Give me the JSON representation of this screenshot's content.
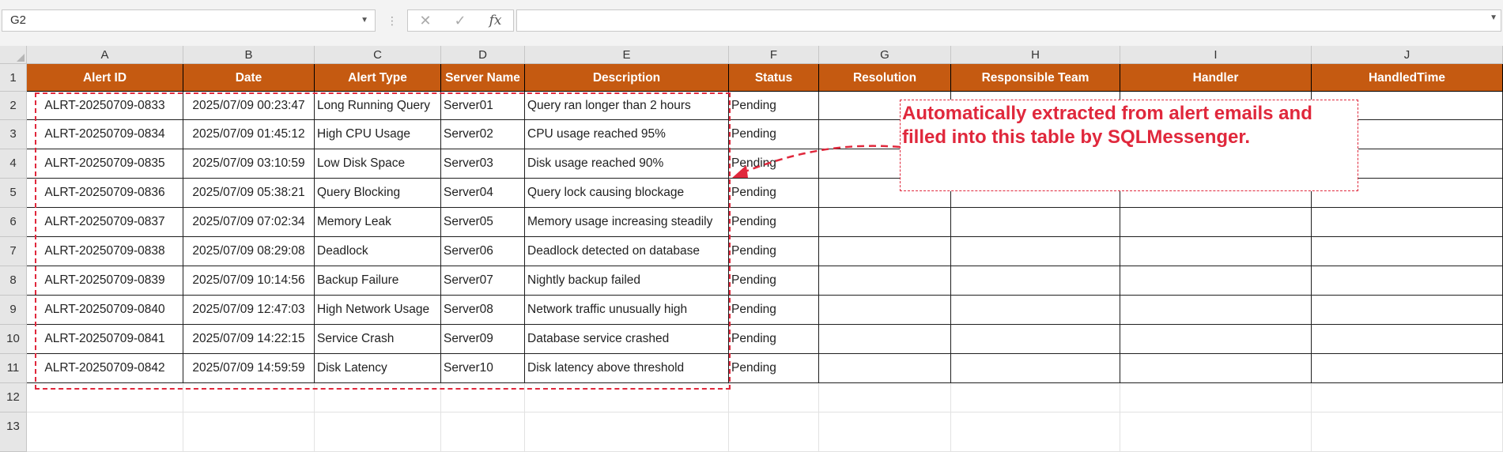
{
  "name_box": {
    "value": "G2"
  },
  "formula_bar": {
    "cancel_icon": "✕",
    "enter_icon": "✓",
    "fx_label": "fx",
    "formula": ""
  },
  "columns": [
    "A",
    "B",
    "C",
    "D",
    "E",
    "F",
    "G",
    "H",
    "I",
    "J"
  ],
  "rows": [
    "1",
    "2",
    "3",
    "4",
    "5",
    "6",
    "7",
    "8",
    "9",
    "10",
    "11",
    "12",
    "13"
  ],
  "table": {
    "headers": [
      "Alert ID",
      "Date",
      "Alert Type",
      "Server Name",
      "Description",
      "Status",
      "Resolution",
      "Responsible Team",
      "Handler",
      "HandledTime"
    ],
    "records": [
      [
        "ALRT-20250709-0833",
        "2025/07/09 00:23:47",
        "Long Running Query",
        "Server01",
        "Query ran longer than 2 hours",
        "Pending",
        "",
        "",
        "",
        ""
      ],
      [
        "ALRT-20250709-0834",
        "2025/07/09 01:45:12",
        "High CPU Usage",
        "Server02",
        "CPU usage reached 95%",
        "Pending",
        "",
        "",
        "",
        ""
      ],
      [
        "ALRT-20250709-0835",
        "2025/07/09 03:10:59",
        "Low Disk Space",
        "Server03",
        "Disk usage reached 90%",
        "Pending",
        "",
        "",
        "",
        ""
      ],
      [
        "ALRT-20250709-0836",
        "2025/07/09 05:38:21",
        "Query Blocking",
        "Server04",
        "Query lock causing blockage",
        "Pending",
        "",
        "",
        "",
        ""
      ],
      [
        "ALRT-20250709-0837",
        "2025/07/09 07:02:34",
        "Memory Leak",
        "Server05",
        "Memory usage increasing steadily",
        "Pending",
        "",
        "",
        "",
        ""
      ],
      [
        "ALRT-20250709-0838",
        "2025/07/09 08:29:08",
        "Deadlock",
        "Server06",
        "Deadlock detected on database",
        "Pending",
        "",
        "",
        "",
        ""
      ],
      [
        "ALRT-20250709-0839",
        "2025/07/09 10:14:56",
        "Backup Failure",
        "Server07",
        "Nightly backup failed",
        "Pending",
        "",
        "",
        "",
        ""
      ],
      [
        "ALRT-20250709-0840",
        "2025/07/09 12:47:03",
        "High Network Usage",
        "Server08",
        "Network traffic unusually high",
        "Pending",
        "",
        "",
        "",
        ""
      ],
      [
        "ALRT-20250709-0841",
        "2025/07/09 14:22:15",
        "Service Crash",
        "Server09",
        "Database service crashed",
        "Pending",
        "",
        "",
        "",
        ""
      ],
      [
        "ALRT-20250709-0842",
        "2025/07/09 14:59:59",
        "Disk Latency",
        "Server10",
        "Disk latency above threshold",
        "Pending",
        "",
        "",
        "",
        ""
      ]
    ]
  },
  "annotation": {
    "text": "Automatically extracted from alert emails and filled into this table by SQLMessenger."
  },
  "colors": {
    "header_fill": "#c55a11",
    "header_text": "#ffffff",
    "annotation": "#e0283c"
  }
}
